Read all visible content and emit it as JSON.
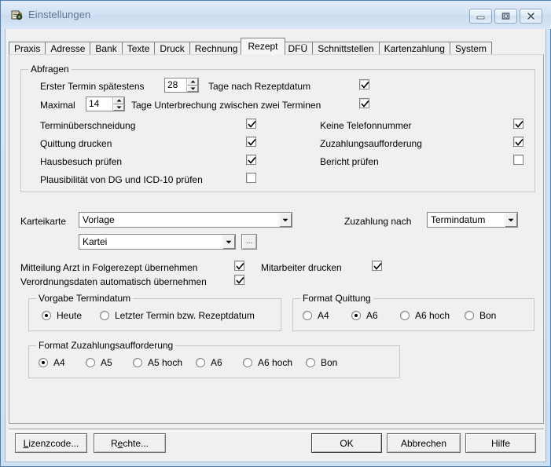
{
  "window": {
    "title": "Einstellungen",
    "icon": "settings-app-icon",
    "buttons": {
      "minimize": "minimize-icon",
      "maximize": "maximize-icon",
      "close": "close-icon"
    }
  },
  "tabs": [
    {
      "label": "Praxis",
      "active": false
    },
    {
      "label": "Adresse",
      "active": false
    },
    {
      "label": "Bank",
      "active": false
    },
    {
      "label": "Texte",
      "active": false
    },
    {
      "label": "Druck",
      "active": false
    },
    {
      "label": "Rechnung",
      "active": false
    },
    {
      "label": "Rezept",
      "active": true
    },
    {
      "label": "DFÜ",
      "active": false
    },
    {
      "label": "Schnittstellen",
      "active": false
    },
    {
      "label": "Kartenzahlung",
      "active": false
    },
    {
      "label": "System",
      "active": false
    }
  ],
  "abfragen": {
    "legend": "Abfragen",
    "erster_termin_label": "Erster Termin spätestens",
    "erster_termin_value": "28",
    "erster_termin_suffix": "Tage nach Rezeptdatum",
    "erster_termin_checked": true,
    "maximal_label": "Maximal",
    "maximal_value": "14",
    "maximal_suffix": "Tage Unterbrechung zwischen zwei Terminen",
    "maximal_checked": true,
    "left_options": [
      {
        "label": "Terminüberschneidung",
        "checked": true
      },
      {
        "label": "Quittung drucken",
        "checked": true
      },
      {
        "label": "Hausbesuch prüfen",
        "checked": true
      },
      {
        "label": "Plausibilität von DG und ICD-10 prüfen",
        "checked": false
      }
    ],
    "right_options": [
      {
        "label": "Keine Telefonnummer",
        "checked": true
      },
      {
        "label": "Zuzahlungsaufforderung",
        "checked": true
      },
      {
        "label": "Bericht prüfen",
        "checked": false
      }
    ]
  },
  "karteikarte": {
    "label": "Karteikarte",
    "vorlage_value": "Vorlage",
    "kartei_value": "Kartei",
    "browse_label": "...",
    "zuzahlung_label": "Zuzahlung nach",
    "zuzahlung_value": "Termindatum"
  },
  "transfer_options": [
    {
      "label": "Mitteilung Arzt in Folgerezept übernehmen",
      "checked": true
    },
    {
      "label": "Verordnungsdaten automatisch übernehmen",
      "checked": true
    }
  ],
  "mitarbeiter": {
    "label": "Mitarbeiter drucken",
    "checked": true
  },
  "vorgabe_termindatum": {
    "legend": "Vorgabe Termindatum",
    "options": [
      {
        "label": "Heute",
        "selected": true
      },
      {
        "label": "Letzter Termin bzw. Rezeptdatum",
        "selected": false
      }
    ]
  },
  "format_quittung": {
    "legend": "Format Quittung",
    "options": [
      {
        "label": "A4",
        "selected": false
      },
      {
        "label": "A6",
        "selected": true
      },
      {
        "label": "A6 hoch",
        "selected": false
      },
      {
        "label": "Bon",
        "selected": false
      }
    ]
  },
  "format_zuzahlung": {
    "legend": "Format Zuzahlungsaufforderung",
    "options": [
      {
        "label": "A4",
        "selected": true
      },
      {
        "label": "A5",
        "selected": false
      },
      {
        "label": "A5 hoch",
        "selected": false
      },
      {
        "label": "A6",
        "selected": false
      },
      {
        "label": "A6 hoch",
        "selected": false
      },
      {
        "label": "Bon",
        "selected": false
      }
    ]
  },
  "footer": {
    "lizenzcode": "Lizenzcode...",
    "rechte": "Rechte...",
    "ok": "OK",
    "abbrechen": "Abbrechen",
    "hilfe": "Hilfe"
  }
}
